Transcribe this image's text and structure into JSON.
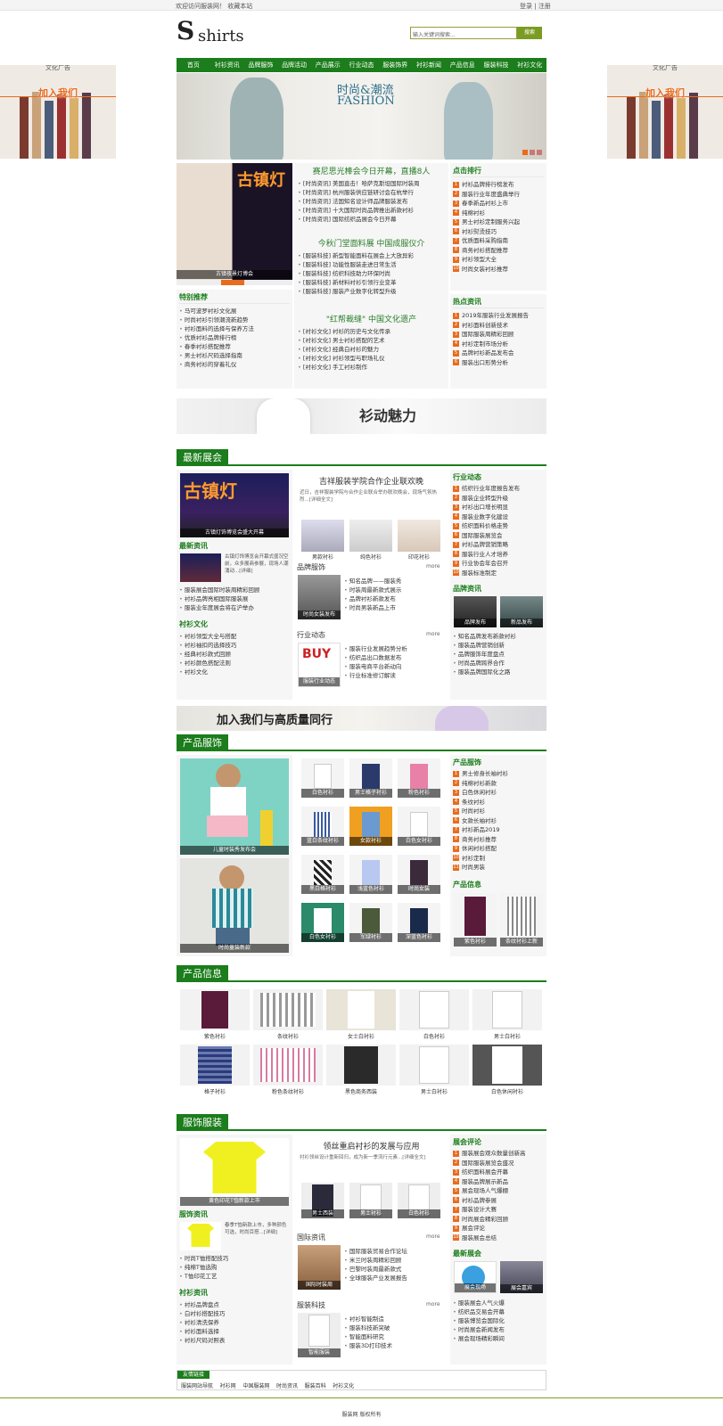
{
  "topbar": {
    "left": "欢迎访问服装网！ 收藏本站",
    "right": "登录 | 注册"
  },
  "logo": {
    "mark": "S",
    "text": "shirts"
  },
  "search": {
    "placeholder": "输入关键词搜索...",
    "button": "搜索"
  },
  "nav": [
    "首页",
    "衬衫资讯",
    "品牌服饰",
    "品牌活动",
    "产品展示",
    "行业动态",
    "服装饰界",
    "衬衫新闻",
    "产品信息",
    "服装科技",
    "衬衫文化"
  ],
  "banner": {
    "text": "时尚&潮流",
    "sub": "FASHION"
  },
  "side_ads": {
    "label": "文化广告",
    "join": "加入我们"
  },
  "top": {
    "photo_caption_l": "古镇灯",
    "photo_caption_r": "古镇夜景灯博会",
    "h1": "赛尼思光棒会今日开幕，直播8人",
    "list1": [
      "[时尚资讯] 美国直击！哈萨克斯坦国际时装周",
      "[时尚资讯] 杭州服装供应链研讨会在杭举行",
      "[时尚资讯] 法国知名设计师品牌服装发布",
      "[时尚资讯] 十大国际时尚品牌推出新款衬衫",
      "[时尚资讯] 国际纺织品展会今日开幕"
    ],
    "h2": "今秋门堂面料展 中国成服仪介",
    "list2": [
      "[服装科技] 新型智能面料在展会上大放异彩",
      "[服装科技] 功能性服装走进日常生活",
      "[服装科技] 纺织科技助力环保时尚",
      "[服装科技] 新材料衬衫引领行业变革",
      "[服装科技] 服装产业数字化转型升级"
    ],
    "h3": "\"红帮裁缝\" 中国文化遗产",
    "list3": [
      "[衬衫文化] 衬衫的历史与文化传承",
      "[衬衫文化] 男士衬衫搭配的艺术",
      "[衬衫文化] 经典白衬衫的魅力",
      "[衬衫文化] 衬衫领型与职场礼仪",
      "[衬衫文化] 手工衬衫制作"
    ]
  },
  "recommend": {
    "title": "特别推荐",
    "items": [
      "马可波罗衬衫文化展",
      "时尚衬衫引领潮流新趋势",
      "衬衫面料的选择与保养方法",
      "优质衬衫品牌排行榜",
      "春季衬衫搭配推荐",
      "男士衬衫尺码选择指南",
      "商务衬衫的穿着礼仪"
    ]
  },
  "hot": {
    "title": "点击排行",
    "items": [
      "衬衫品牌排行榜发布",
      "服装行业年度盛典举行",
      "春季新品衬衫上市",
      "纯棉衬衫",
      "男士衬衫定制服务兴起",
      "衬衫熨烫技巧",
      "优质面料采购指南",
      "商务衬衫搭配推荐",
      "衬衫领型大全",
      "时尚女装衬衫推荐"
    ]
  },
  "hotnews": {
    "title": "热点资讯",
    "items": [
      "2019年服装行业发展报告",
      "衬衫面料创新技术",
      "国际服装周精彩回顾",
      "衬衫定制市场分析",
      "品牌衬衫新品发布会",
      "服装出口形势分析"
    ]
  },
  "wide1": "衫动魅力",
  "sec1": {
    "title": "最新展会",
    "photo_caption": "古镇灯饰博览会盛大开幕",
    "news_title": "最新资讯",
    "news_item": "古镇灯饰博览会开幕式盛况空前，众多展商参展，现场人潮涌动...[详细]",
    "news_list": [
      "服装展会国际时装周精彩回顾",
      "衬衫品牌亮相国际服装展",
      "服装业年度展会将在沪举办"
    ],
    "culture_title": "衬衫文化",
    "culture_list": [
      "衬衫领型大全与搭配",
      "衬衫袖扣的选择技巧",
      "经典衬衫款式回顾",
      "衬衫颜色搭配法则",
      "衬衫文化"
    ],
    "center_h": "吉祥服装学院合作企业联欢晚",
    "center_p": "近日，吉祥服装学院与合作企业联合举办联欢晚会，现场气氛热烈...[详细全文]",
    "thumbs": [
      "男款衬衫",
      "纯色衬衫",
      "印花衬衫"
    ],
    "brand_title": "品牌服饰",
    "more": "more",
    "brand_cap": "时尚女装发布",
    "brand_list": [
      "知名品牌——服装秀",
      "时装周最新款式展示",
      "品牌衬衫新款发布",
      "时尚男装新品上市"
    ],
    "industry_title": "行业动态",
    "industry_cap": "服装行业动态",
    "industry_list": [
      "服装行业发展趋势分析",
      "纺织品出口数据发布",
      "服装电商平台新动向",
      "行业标准修订解读"
    ],
    "right1_title": "行业动态",
    "right1_list": [
      "纺织行业年度报告发布",
      "服装企业转型升级",
      "衬衫出口增长明显",
      "服装业数字化建设",
      "纺织面料价格走势",
      "国际服装展览会",
      "衬衫品牌营销策略",
      "服装行业人才培养",
      "行业协会年会召开",
      "服装标准制定"
    ],
    "right2_title": "品牌资讯",
    "right2_caps": [
      "品牌发布",
      "新品发布"
    ],
    "right2_list": [
      "知名品牌发布新款衬衫",
      "服装品牌营销创新",
      "品牌服饰年度盘点",
      "时尚品牌跨界合作",
      "服装品牌国际化之路"
    ]
  },
  "wide2": "加入我们与高质量同行",
  "sec2": {
    "title": "产品服饰",
    "left_caps": [
      "儿童时装秀发布会",
      "时尚童装新款"
    ],
    "grid": [
      "白色衬衫",
      "男士格子衬衫",
      "粉色衬衫",
      "蓝白条纹衬衫",
      "女款衬衫",
      "白色女衬衫",
      "黑白格衬衫",
      "浅蓝色衬衫",
      "时尚女装",
      "白色女衬衫",
      "军绿衬衫",
      "深蓝色衬衫"
    ],
    "r_title": "产品服饰",
    "r_list": [
      "男士修身长袖衬衫",
      "纯棉衬衫新款",
      "白色休闲衬衫",
      "条纹衬衫",
      "时尚衬衫",
      "女款长袖衬衫",
      "衬衫新品2019",
      "商务衬衫推荐",
      "休闲衬衫搭配",
      "衬衫定制",
      "时尚男装"
    ],
    "r2_title": "产品信息",
    "r2_caps": [
      "紫色衬衫",
      "条纹衬衫上新"
    ]
  },
  "sec3": {
    "title": "产品信息",
    "row1": [
      "紫色衬衫",
      "条纹衬衫",
      "女士白衬衫",
      "白色衬衫",
      "男士白衬衫"
    ],
    "row2": [
      "格子衬衫",
      "粉色条纹衬衫",
      "黑色商务西装",
      "男士白衬衫",
      "白色休闲衬衫"
    ]
  },
  "sec4": {
    "title": "服饰服装",
    "tshirt_cap": "黄色印花T恤新款上市",
    "news_title": "服饰资讯",
    "news_item": "春季T恤新款上市，多种颜色可选，时尚百搭...[详细]",
    "news_list": [
      "时尚T恤搭配技巧",
      "纯棉T恤选购",
      "T恤印花工艺"
    ],
    "info_title": "衬衫资讯",
    "info_list": [
      "衬衫品牌盘点",
      "白衬衫搭配技巧",
      "衬衫清洗保养",
      "衬衫面料选择",
      "衬衫尺码对照表"
    ],
    "center_h": "领丝重启衬衫的发展与应用",
    "center_p": "衬衫领丝设计重新回归，成为新一季流行元素...[详细全文]",
    "thumbs": [
      "男士西装",
      "男士衬衫",
      "白色衬衫"
    ],
    "intl_title": "国际资讯",
    "more": "more",
    "intl_cap": "国际时装周",
    "intl_list": [
      "国际服装贸易合作论坛",
      "米兰时装周精彩回顾",
      "巴黎时装周最新款式",
      "全球服装产业发展报告"
    ],
    "mkt_title": "服装科技",
    "mkt_cap": "智能服装",
    "mkt_list": [
      "衬衫智能制造",
      "服装科技新突破",
      "智能面料研究",
      "服装3D打印技术"
    ],
    "r_title": "展会评论",
    "r_list": [
      "服装展会观众数量创新高",
      "国际服装展览会盛况",
      "纺织面料展会开幕",
      "服装品牌展示新品",
      "展会现场人气爆棚",
      "衬衫品牌参展",
      "服装设计大赛",
      "时尚展会精彩回顾",
      "展会评论",
      "服装展会总结"
    ],
    "r2_title": "最新展会",
    "r2_caps": [
      "展会现场",
      "展会嘉宾"
    ],
    "r2_list": [
      "服装展会人气火爆",
      "纺织品交易会开幕",
      "服装博览会国际化",
      "时尚展会新闻发布",
      "展会现场精彩瞬间"
    ]
  },
  "links": {
    "title": "友情链接",
    "items": [
      "服装网站导航",
      "衬衫网",
      "中国服装网",
      "时尚资讯",
      "服装百科",
      "衬衫文化"
    ]
  },
  "footer": "服装网 版权所有"
}
